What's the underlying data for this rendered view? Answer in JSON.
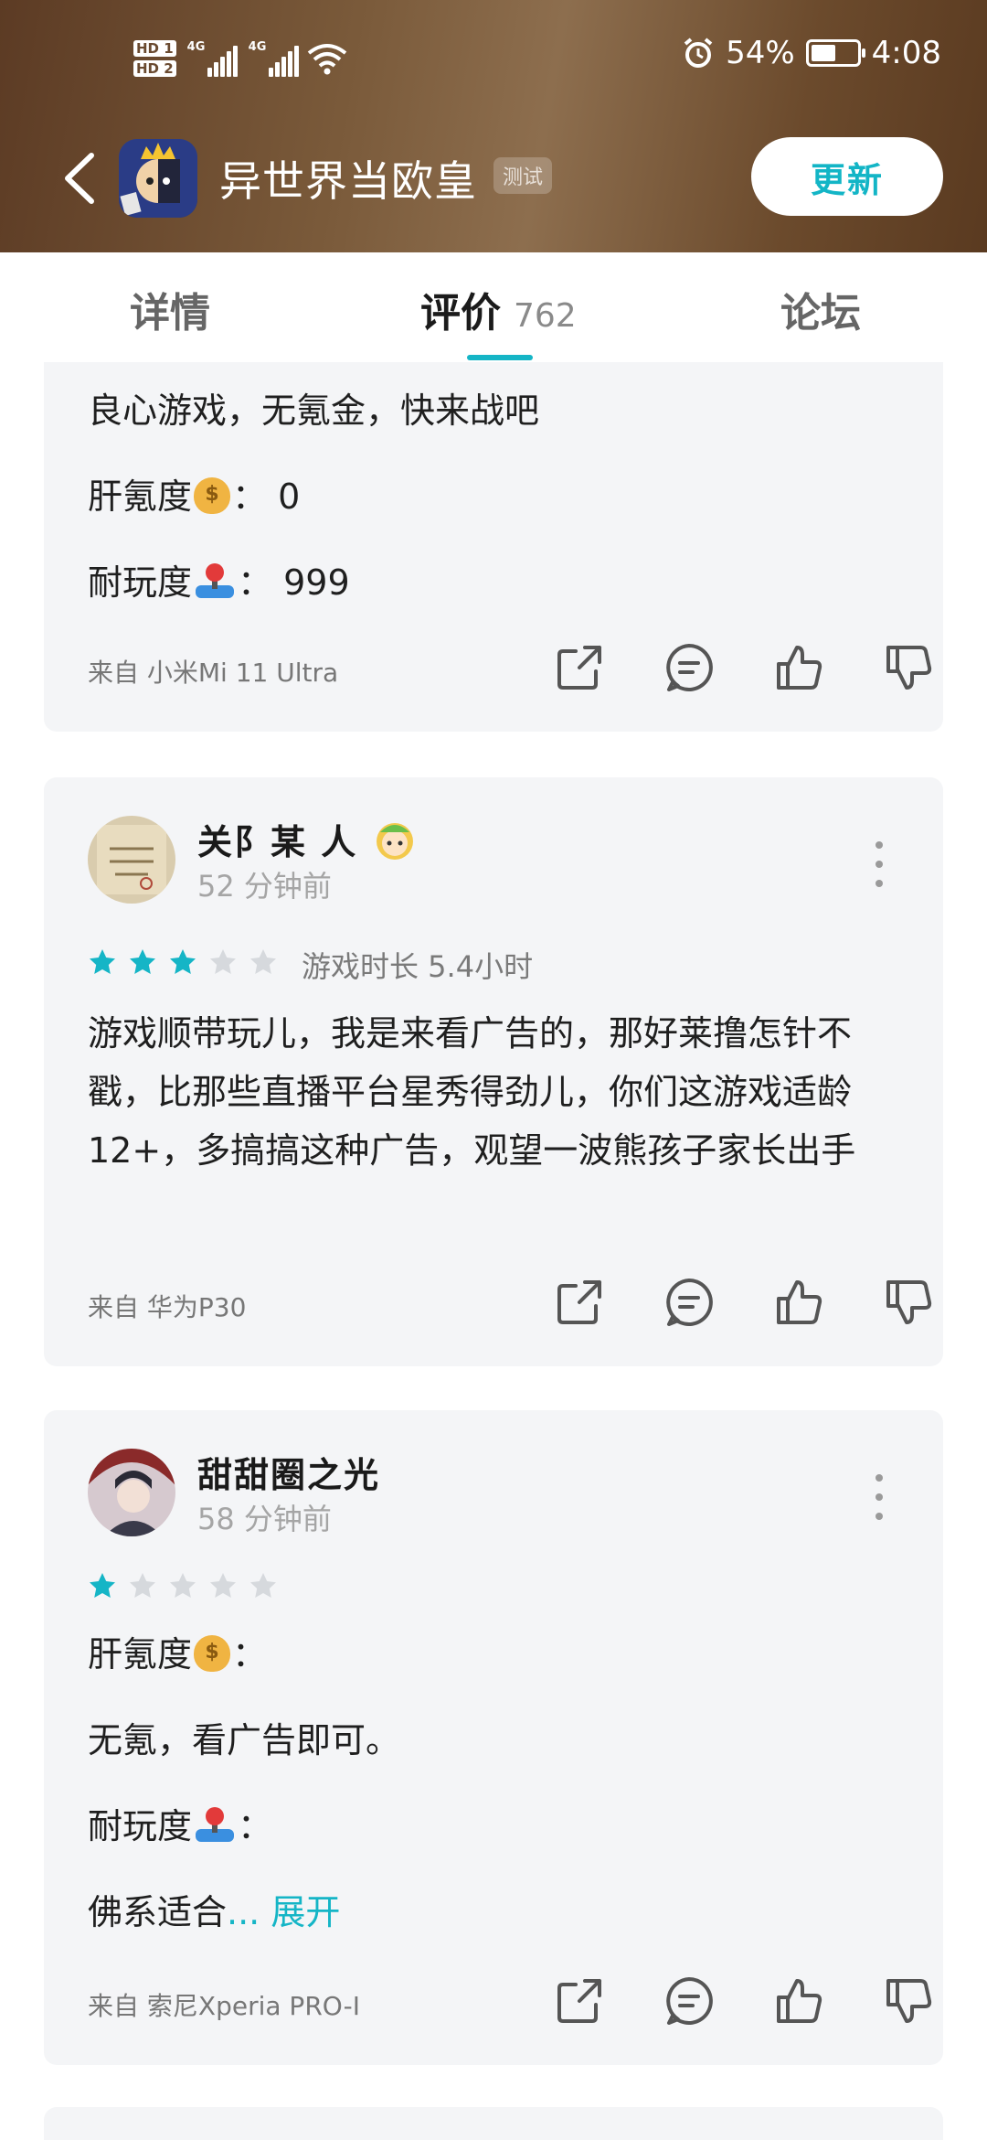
{
  "status_bar": {
    "hd1": "HD 1",
    "hd2": "HD 2",
    "signal1": "4G",
    "signal2": "4G",
    "battery": "54%",
    "battery_level": 0.54,
    "time": "4:08"
  },
  "app": {
    "title": "异世界当欧皇",
    "badge": "测试",
    "update_label": "更新"
  },
  "tabs": [
    {
      "label": "详情"
    },
    {
      "label": "评价",
      "count": "762"
    },
    {
      "label": "论坛"
    }
  ],
  "reviews": [
    {
      "lines": [
        "良心游戏，无氪金，快来战吧",
        "肝氪度",
        "：  0",
        "耐玩度",
        "：  999"
      ],
      "device": "来自 小米Mi 11 Ultra"
    },
    {
      "username": "关阝某 人",
      "time": "52 分钟前",
      "rating": 3,
      "playtime": "游戏时长 5.4小时",
      "body": "游戏顺带玩儿，我是来看广告的，那好莱撸怎针不戳，比那些直播平台星秀得劲儿，你们这游戏适龄12+，多搞搞这种广告，观望一波熊孩子家长出手",
      "device": "来自 华为P30"
    },
    {
      "username": "甜甜圈之光",
      "time": "58 分钟前",
      "rating": 1,
      "lines": [
        "肝氪度",
        "：",
        "无氪，看广告即可。",
        "耐玩度",
        "：",
        "佛系适合",
        "... 展开"
      ],
      "device": "来自 索尼Xperia PRO-I"
    }
  ],
  "colors": {
    "accent": "#15b5c6",
    "card_bg": "#f4f5f7",
    "star_on": "#15b5c6",
    "star_off": "#d6d9dd"
  }
}
